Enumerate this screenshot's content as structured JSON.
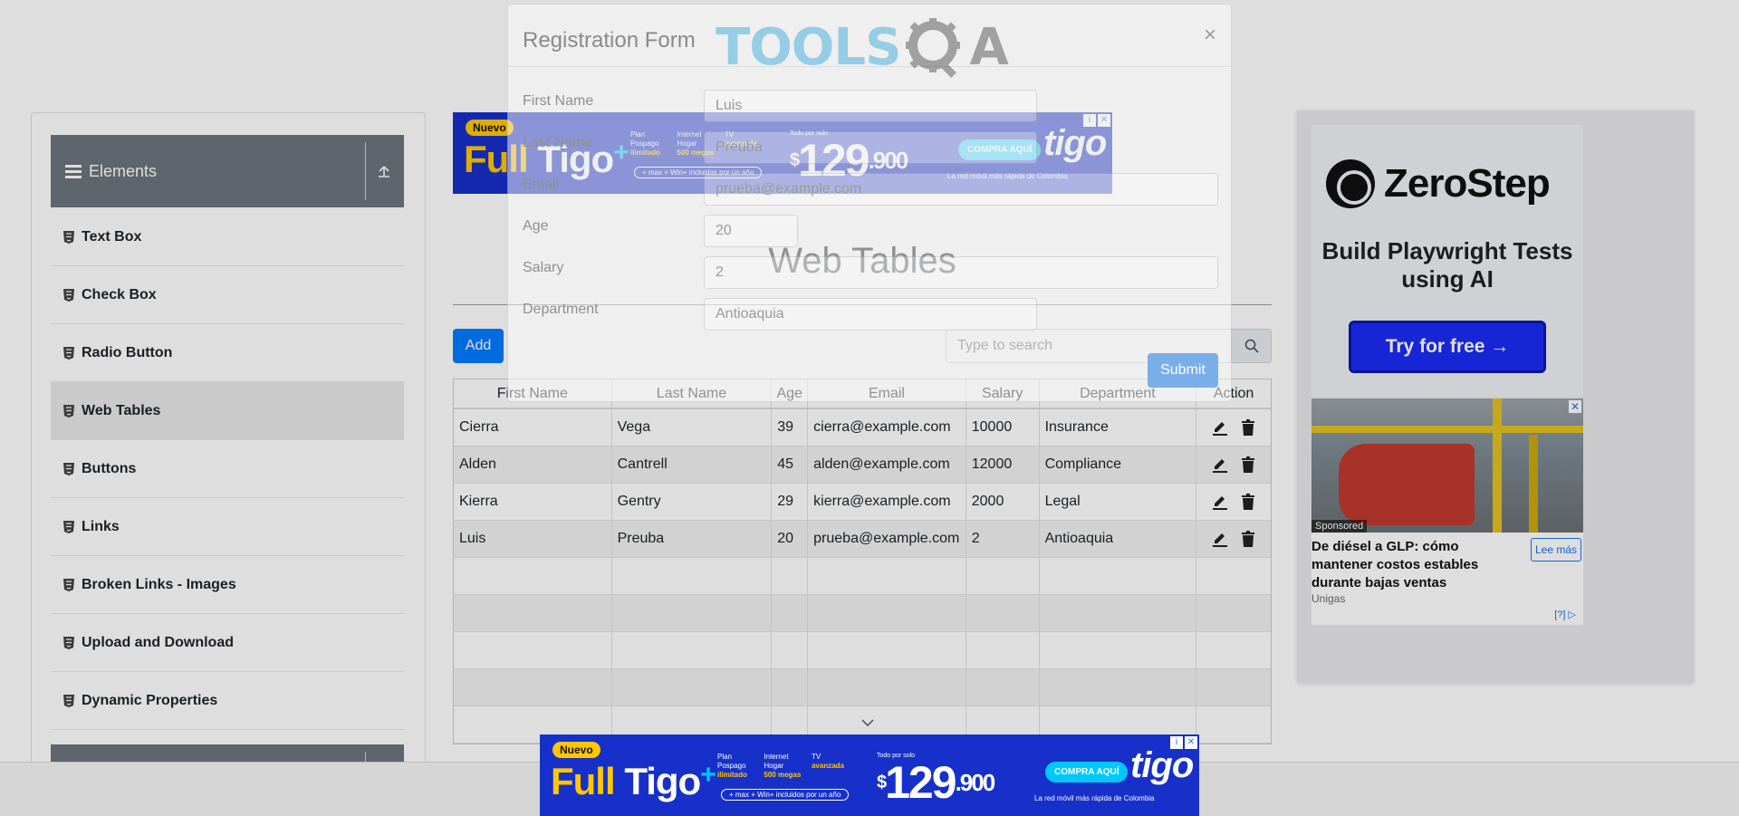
{
  "logo": {
    "word": "TOOLS",
    "letter": "A"
  },
  "sidebar": {
    "group_title": "Elements",
    "items": [
      {
        "label": "Text Box"
      },
      {
        "label": "Check Box"
      },
      {
        "label": "Radio Button"
      },
      {
        "label": "Web Tables",
        "active": true
      },
      {
        "label": "Buttons"
      },
      {
        "label": "Links"
      },
      {
        "label": "Broken Links - Images"
      },
      {
        "label": "Upload and Download"
      },
      {
        "label": "Dynamic Properties"
      }
    ]
  },
  "main": {
    "title": "Web Tables",
    "add_label": "Add",
    "search_placeholder": "Type to search",
    "columns": [
      "First Name",
      "Last Name",
      "Age",
      "Email",
      "Salary",
      "Department",
      "Action"
    ],
    "rows": [
      [
        "Cierra",
        "Vega",
        "39",
        "cierra@example.com",
        "10000",
        "Insurance"
      ],
      [
        "Alden",
        "Cantrell",
        "45",
        "alden@example.com",
        "12000",
        "Compliance"
      ],
      [
        "Kierra",
        "Gentry",
        "29",
        "kierra@example.com",
        "2000",
        "Legal"
      ],
      [
        "Luis",
        "Preuba",
        "20",
        "prueba@example.com",
        "2",
        "Antioaquia"
      ]
    ],
    "empty_rows": 5
  },
  "modal": {
    "title": "Registration Form",
    "close": "×",
    "labels": {
      "first_name": "First Name",
      "last_name": "Last Name",
      "email": "Email",
      "age": "Age",
      "salary": "Salary",
      "department": "Department"
    },
    "values": {
      "first_name": "Luis",
      "last_name": "Preuba",
      "email": "prueba@example.com",
      "age": "20",
      "salary": "2",
      "department": "Antioaquia"
    },
    "submit_label": "Submit"
  },
  "ads": {
    "zerostep": {
      "name": "ZeroStep",
      "tagline": "Build Playwright Tests using AI",
      "cta": "Try for free →"
    },
    "native": {
      "sponsored": "Sponsored",
      "headline": "De diésel a GLP: cómo mantener costos estables durante bajas ventas",
      "cta": "Lee más",
      "source": "Unigas",
      "choices": "[?]"
    },
    "tigo": {
      "badge": "Nuevo",
      "brand_full": "Full",
      "brand_tigo": "Tigo",
      "feat1_title": "Plan Pospago",
      "feat1_sub": "ilimitado",
      "feat2_title": "Internet Hogar",
      "feat2_sub": "500 megas",
      "feat3_title": "TV",
      "feat3_sub": "avanzada",
      "bundle": "+ max + Win+ incluidos por un año",
      "price_label": "Todo por solo",
      "currency": "$",
      "price": "129",
      "price_dec": ".900",
      "cta": "COMPRA AQUÍ",
      "logo": "tigo",
      "tagline": "La red móvil más rápida de Colombia"
    }
  },
  "colors": {
    "primary": "#007bff",
    "sidebar_header": "#6c757d",
    "tigo_blue": "#1730c9",
    "zerostep_cta": "#1a2cf5"
  }
}
